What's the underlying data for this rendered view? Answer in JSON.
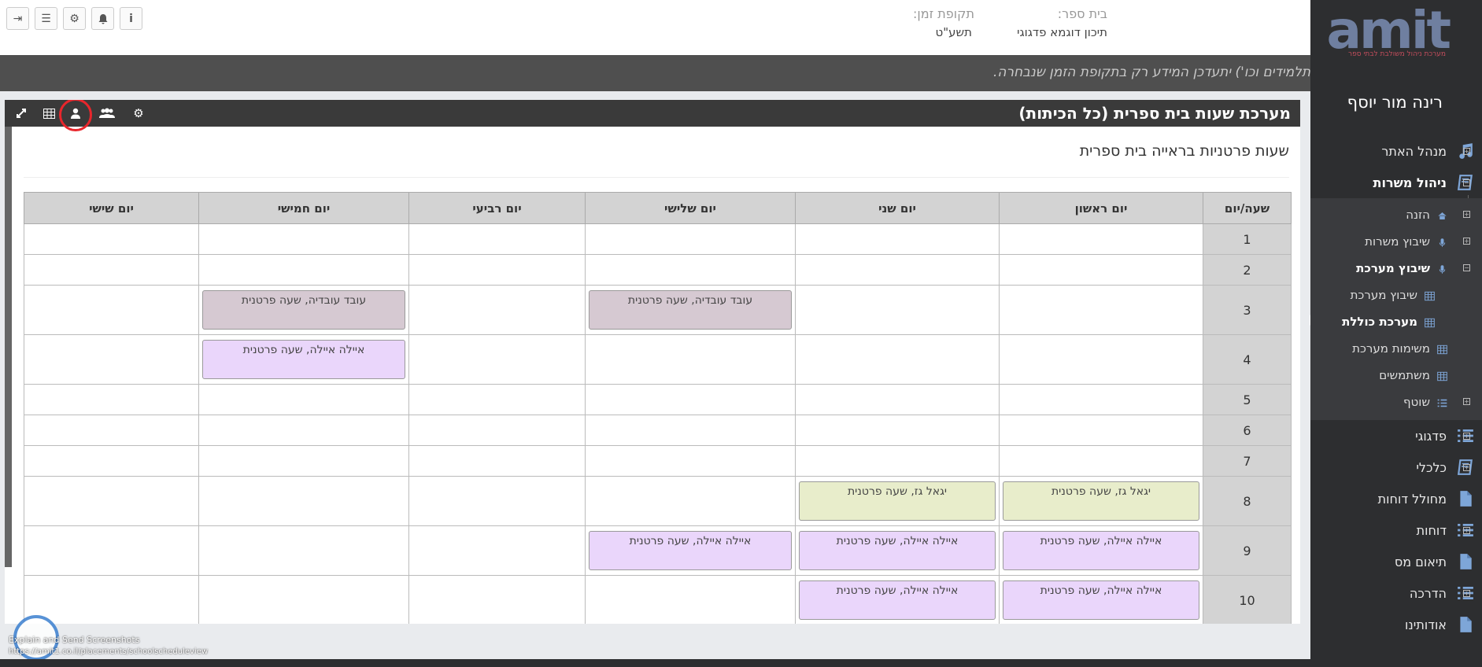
{
  "sidebar": {
    "logo": "amit",
    "logo_sub": "מערכת ניהול משולבת לבתי ספר",
    "user_name": "רינה מור יוסף",
    "items": [
      {
        "label": "מנהל האתר",
        "icon": "music-icon",
        "expand": "+"
      },
      {
        "label": "ניהול משרות",
        "icon": "book-icon",
        "expand": "−"
      }
    ],
    "sub_items": [
      {
        "label": "הזנה",
        "icon": "home-icon",
        "expand": "+"
      },
      {
        "label": "שיבוץ משרות",
        "icon": "mic-icon",
        "expand": "+"
      },
      {
        "label": "שיבוץ מערכת",
        "icon": "mic-icon",
        "expand": "−"
      }
    ],
    "sub_sub_items": [
      {
        "label": "שיבוץ מערכת",
        "icon": "grid-icon"
      },
      {
        "label": "מערכת כוללת",
        "icon": "grid-icon"
      }
    ],
    "sub_items2": [
      {
        "label": "משימות מערכת",
        "icon": "grid-icon"
      },
      {
        "label": "משתמשים",
        "icon": "grid-icon"
      },
      {
        "label": "שוטף",
        "icon": "list-icon",
        "expand": "+"
      }
    ],
    "items2": [
      {
        "label": "פדגוגי",
        "icon": "list-icon",
        "expand": "+"
      },
      {
        "label": "כלכלי",
        "icon": "book-icon",
        "expand": "+"
      },
      {
        "label": "מחולל דוחות",
        "icon": "file-icon",
        "expand": ""
      },
      {
        "label": "דוחות",
        "icon": "list-icon",
        "expand": "+"
      },
      {
        "label": "תיאום מס",
        "icon": "file-icon",
        "expand": ""
      },
      {
        "label": "הדרכה",
        "icon": "list-icon",
        "expand": "+"
      },
      {
        "label": "אודותינו",
        "icon": "file-icon",
        "expand": ""
      }
    ]
  },
  "header": {
    "school_label": "בית ספר:",
    "school_value": "תיכון דוגמא פדגוגי",
    "period_label": "תקופת זמן:",
    "period_value": "תשע\"ט"
  },
  "notice": "תלמידים וכו') יתעדכן המידע רק בתקופת הזמן שנבחרה.",
  "panel": {
    "title": "מערכת שעות בית ספרית (כל הכיתות)",
    "subtitle": "שעות פרטניות בראייה בית ספרית"
  },
  "schedule": {
    "headers": [
      "שעה/יום",
      "יום ראשון",
      "יום שני",
      "יום שלישי",
      "יום רביעי",
      "יום חמישי",
      "יום שישי"
    ],
    "rows": [
      {
        "hour": "1",
        "cells": [
          "",
          "",
          "",
          "",
          "",
          ""
        ]
      },
      {
        "hour": "2",
        "cells": [
          "",
          "",
          "",
          "",
          "",
          ""
        ]
      },
      {
        "hour": "3",
        "cells": [
          "",
          "",
          "עובד עובדיה, שעה פרטנית",
          "",
          "עובד עובדיה, שעה פרטנית",
          ""
        ]
      },
      {
        "hour": "4",
        "cells": [
          "",
          "",
          "",
          "",
          "איילה איילה, שעה פרטנית",
          ""
        ]
      },
      {
        "hour": "5",
        "cells": [
          "",
          "",
          "",
          "",
          "",
          ""
        ]
      },
      {
        "hour": "6",
        "cells": [
          "",
          "",
          "",
          "",
          "",
          ""
        ]
      },
      {
        "hour": "7",
        "cells": [
          "",
          "",
          "",
          "",
          "",
          ""
        ]
      },
      {
        "hour": "8",
        "cells": [
          "יגאל גז, שעה פרטנית",
          "יגאל גז, שעה פרטנית",
          "",
          "",
          "",
          ""
        ]
      },
      {
        "hour": "9",
        "cells": [
          "איילה איילה, שעה פרטנית",
          "איילה איילה, שעה פרטנית",
          "איילה איילה, שעה פרטנית",
          "",
          "",
          ""
        ]
      },
      {
        "hour": "10",
        "cells": [
          "איילה איילה, שעה פרטנית",
          "איילה איילה, שעה פרטנית",
          "",
          "",
          "",
          ""
        ]
      }
    ]
  },
  "colors": {
    "ovad": "#d6c9d2",
    "ayala": "#ead6fb",
    "yigal": "#e8edcb"
  },
  "footer": {
    "line1": "Explain and Send Screenshots",
    "line2": "https://amit1.co.il/placements/schoolscheduleview"
  }
}
